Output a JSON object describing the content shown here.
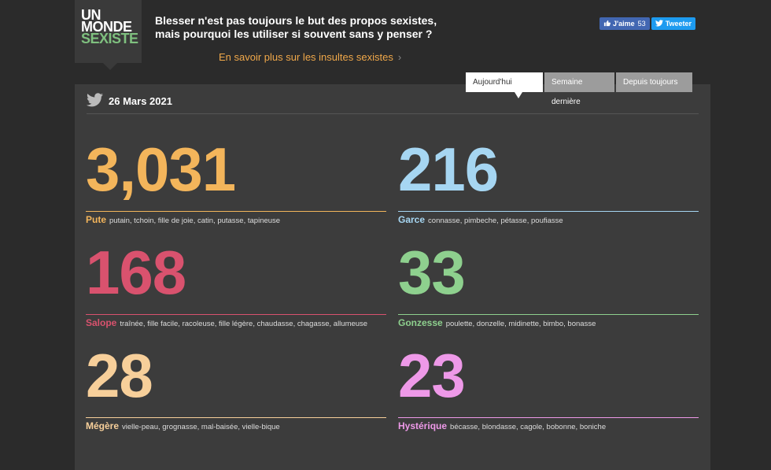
{
  "logo": {
    "line1": "UN",
    "line2": "MONDE",
    "line3": "SEXISTE"
  },
  "tagline": "Blesser n'est pas toujours le but des propos sexistes, mais pourquoi les utiliser si souvent sans y penser ?",
  "learn_more": {
    "label": "En savoir plus sur les insultes sexistes",
    "chevron": "›"
  },
  "social": {
    "fb_label": "J'aime",
    "fb_count": "53",
    "tw_label": "Tweeter"
  },
  "tabs": [
    {
      "label": "Aujourd'hui",
      "active": true
    },
    {
      "label": "Semaine dernière",
      "active": false
    },
    {
      "label": "Depuis toujours",
      "active": false
    }
  ],
  "date": "26 Mars 2021",
  "stats": [
    {
      "value": "3,031",
      "word": "Pute",
      "synonyms": "putain, tchoin, fille de joie, catin, putasse, tapineuse",
      "color": "#f3b55b"
    },
    {
      "value": "216",
      "word": "Garce",
      "synonyms": "connasse, pimbeche, pétasse, poufiasse",
      "color": "#a6d6f2"
    },
    {
      "value": "168",
      "word": "Salope",
      "synonyms": "traînée, fille facile, racoleuse, fille légère, chaudasse, chagasse, allumeuse",
      "color": "#d9526e"
    },
    {
      "value": "33",
      "word": "Gonzesse",
      "synonyms": "poulette, donzelle, midinette, bimbo, bonasse",
      "color": "#8ed08e"
    },
    {
      "value": "28",
      "word": "Mégère",
      "synonyms": "vielle-peau, grognasse, mal-baisée, vielle-bique",
      "color": "#f7cf9a"
    },
    {
      "value": "23",
      "word": "Hystérique",
      "synonyms": "bécasse, blondasse, cagole, bobonne, boniche",
      "color": "#ee99e8"
    }
  ]
}
